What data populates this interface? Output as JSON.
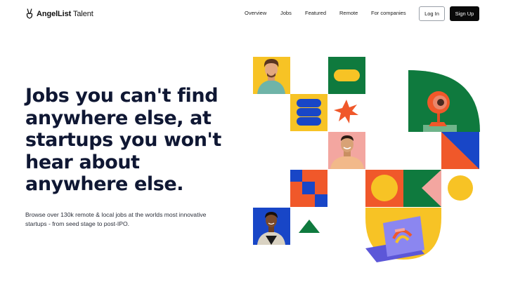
{
  "brand": {
    "name_bold": "AngelList",
    "name_light": " Talent"
  },
  "nav": {
    "links": [
      {
        "label": "Overview"
      },
      {
        "label": "Jobs"
      },
      {
        "label": "Featured"
      },
      {
        "label": "Remote"
      },
      {
        "label": "For companies"
      }
    ],
    "login_label": "Log In",
    "signup_label": "Sign Up"
  },
  "hero": {
    "headline": "Jobs you can't find anywhere else, at startups you won't hear about anywhere else.",
    "subtext": "Browse over 130k remote & local jobs at the worlds most innovative startups - from seed stage to post-IPO."
  },
  "colors": {
    "yellow": "#f7c325",
    "green": "#0f7a3e",
    "blue": "#1846c7",
    "orange": "#f0582a",
    "pink": "#f3a6a0",
    "purple": "#8b86f0",
    "navy": "#0f1733"
  },
  "illustrations": [
    {
      "name": "person-portrait-curly-hair"
    },
    {
      "name": "person-portrait-smiling"
    },
    {
      "name": "person-portrait-woman"
    },
    {
      "name": "webcam-icon"
    },
    {
      "name": "laptop-icon"
    }
  ]
}
